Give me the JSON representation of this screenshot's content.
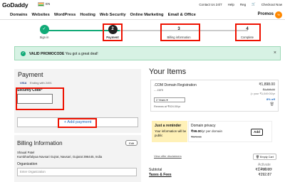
{
  "header": {
    "logo": "GoDaddy",
    "language": "EN",
    "links": [
      "Contact Us 24/7",
      "Help",
      "Reg",
      "Checkout Now"
    ]
  },
  "nav": {
    "items": [
      "Domains",
      "Websites",
      "WordPress",
      "Hosting",
      "Web Security",
      "Online Marketing",
      "Email & Office"
    ],
    "promos": "Promos"
  },
  "steps": [
    {
      "number": "",
      "label": "Sign in",
      "state": "done"
    },
    {
      "number": "2",
      "label": "Payment",
      "state": "active"
    },
    {
      "number": "3",
      "label": "Billing information",
      "state": "todo"
    },
    {
      "number": "4",
      "label": "Complete",
      "state": "todo"
    }
  ],
  "promo_banner": {
    "bold": "VALID PROMOCODE",
    "text": "You got a great deal!",
    "close": "×"
  },
  "payment": {
    "title": "Payment",
    "card_brand": "VISA",
    "card_ending": "Ending with 2491",
    "security_code_label": "Security Code*",
    "security_code_value": "",
    "add_payment": "+ Add payment"
  },
  "billing": {
    "title": "Billing Information",
    "edit": "Edit",
    "name": "Shaual Patel",
    "address": "Kumbharfaliyaa Navsari Gujrat, Navsari, Gujarat 396445, India",
    "org_label": "Organization",
    "org_placeholder": "Enter Organization"
  },
  "items": {
    "title": "Your Items",
    "product": ".COM Domain Registration",
    "domain": "....com",
    "term": "2 Years",
    "renewal": "Renews at ₹924.00/yr",
    "price": "₹1,898.00",
    "strike_price": "₹1,898.00",
    "per_year": "(= your ₹1,049.00/yr",
    "discount": "8% off"
  },
  "reminder": {
    "title": "Just a reminder",
    "text": "Your information will be public"
  },
  "privacy": {
    "title": "Domain privacy",
    "price": "₹99.00",
    "unit": "/yr per domain",
    "strike": "₹579.00",
    "add": "Add"
  },
  "footer": {
    "view_disclaimers": "View offer disclaimers",
    "empty_cart": "Empty Cart",
    "subtotal_label": "Subtotal",
    "subtotal_value": "₹1,498.60",
    "taxes_label": "Taxes & Fees",
    "taxes_value": "₹292.87",
    "activate": "Activate Windows"
  },
  "colors": {
    "accent_green": "#1aa977",
    "highlight_red": "#e01100",
    "link_blue": "#1565c0",
    "banner_bg": "#d7f2e4"
  }
}
